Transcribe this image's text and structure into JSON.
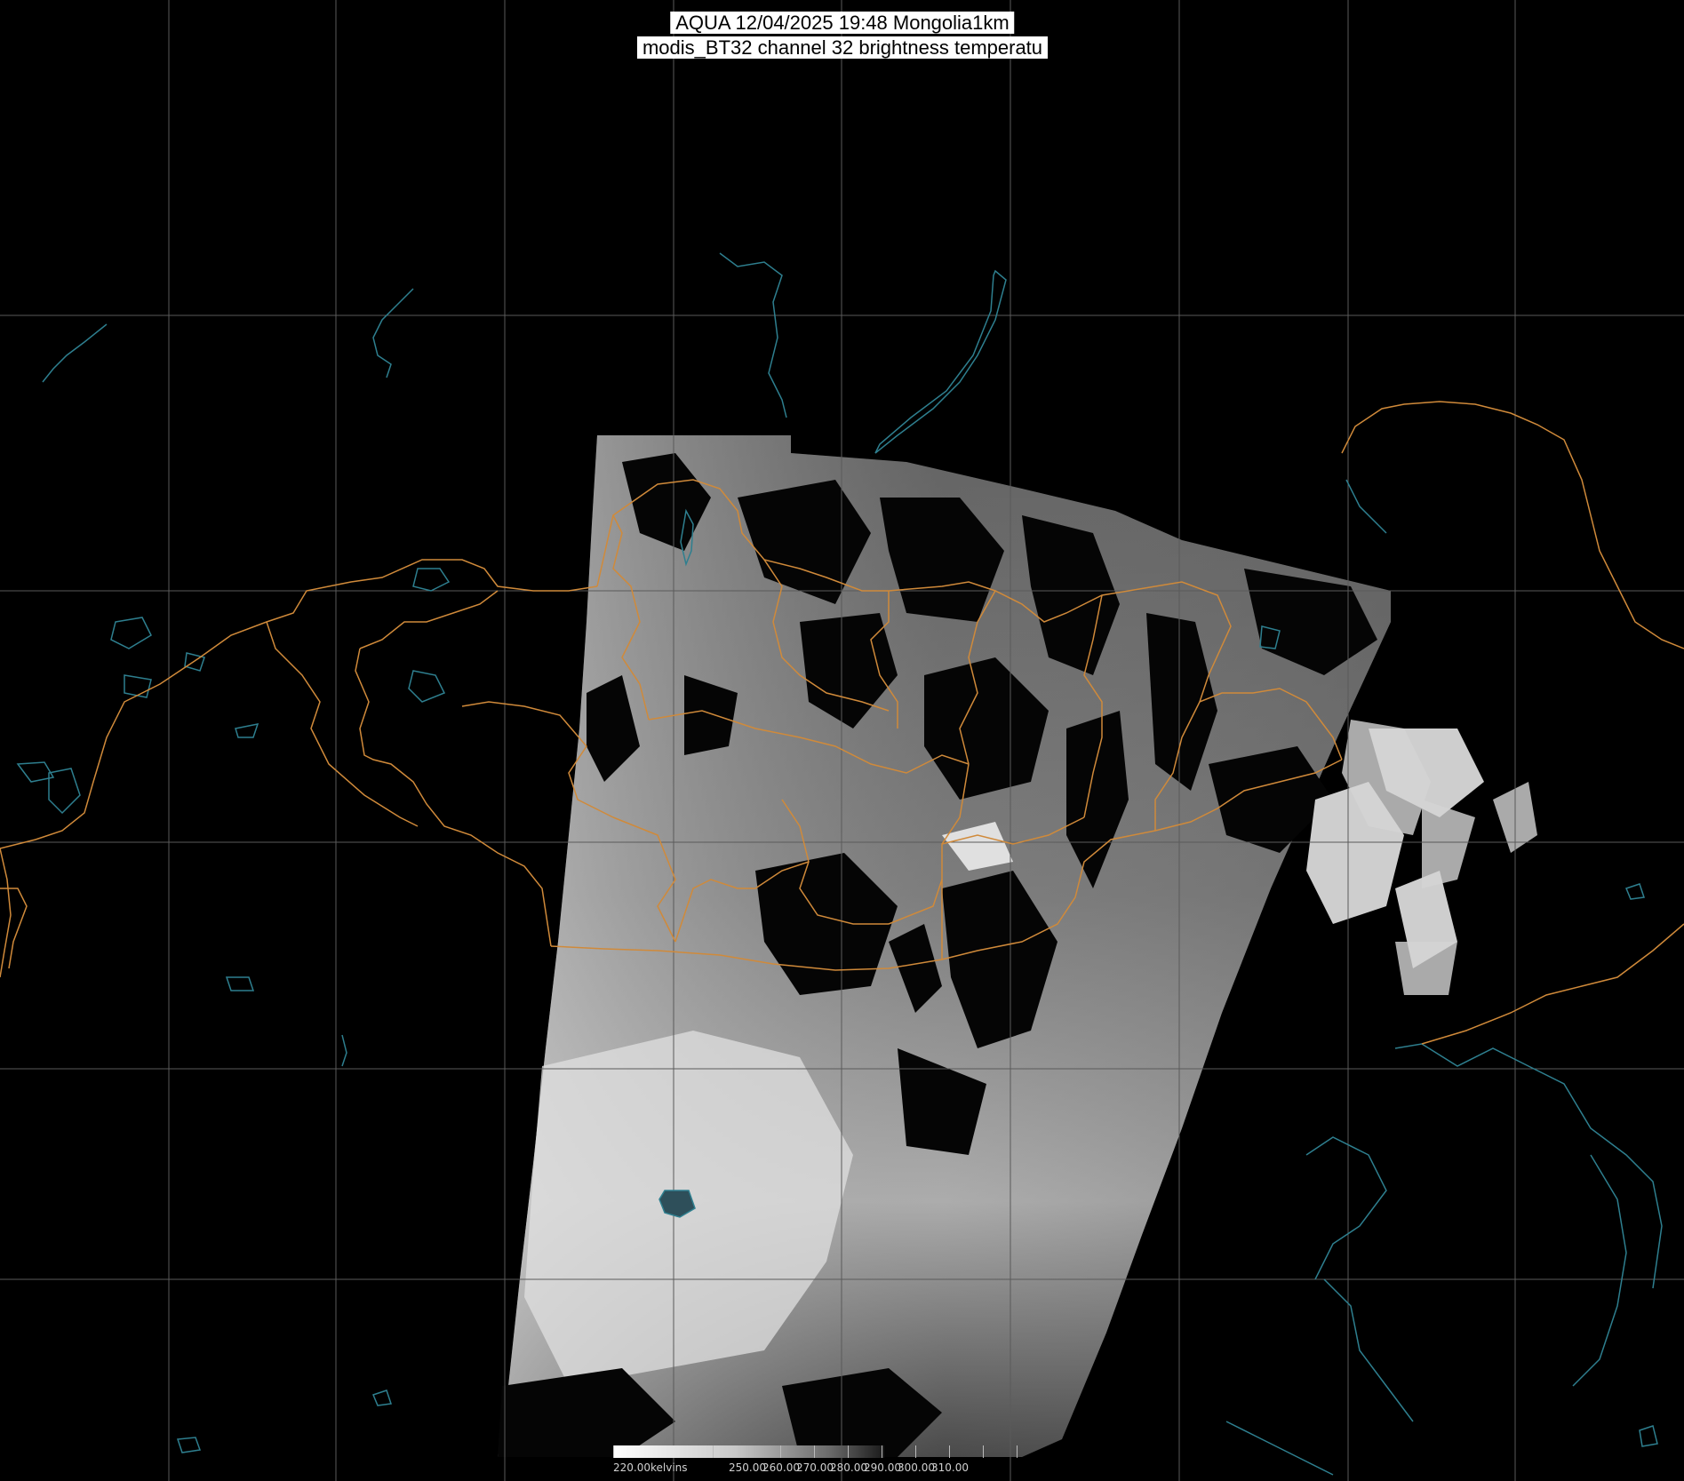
{
  "title": {
    "line1": "AQUA 12/04/2025 19:48 Mongolia1km",
    "line2": "modis_BT32 channel 32 brightness temperatu"
  },
  "colorbar": {
    "labels": [
      "220.00kelvins",
      "250.00",
      "260.00",
      "270.00",
      "280.00",
      "290.00",
      "300.00",
      "310.00"
    ]
  },
  "colors": {
    "background": "#000000",
    "graticule": "#5a5a5a",
    "borders": "#d08a3a",
    "coastlines_lakes": "#2e7f8f",
    "imagery_dark": "#0a0a0a",
    "imagery_light": "#e8e8e8"
  }
}
